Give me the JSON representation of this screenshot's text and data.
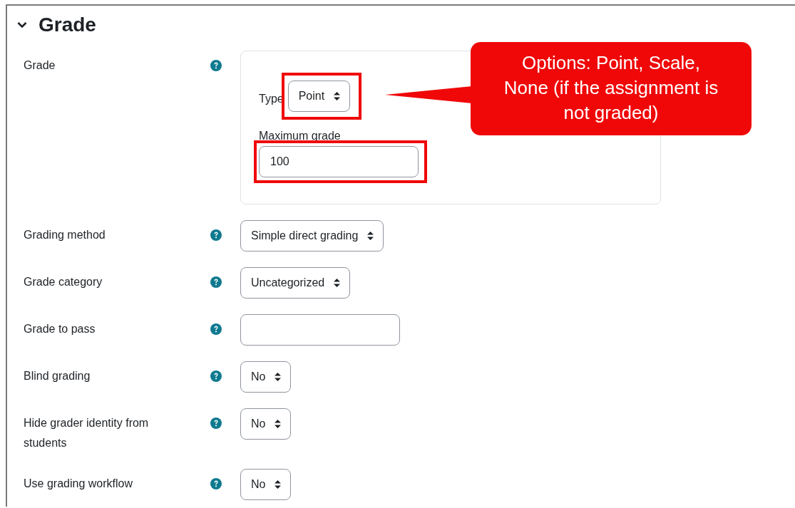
{
  "section": {
    "title": "Grade",
    "expanded": true
  },
  "grade_group": {
    "label": "Grade",
    "type_label": "Type",
    "type_value": "Point",
    "type_highlighted": true,
    "max_label": "Maximum grade",
    "max_value": "100",
    "max_highlighted": true
  },
  "callout": {
    "text": "Options: Point, Scale, None (if the assignment is not graded)"
  },
  "fields": [
    {
      "kind": "select",
      "label": "Grading method",
      "value": "Simple direct grading"
    },
    {
      "kind": "select",
      "label": "Grade category",
      "value": "Uncategorized"
    },
    {
      "kind": "input",
      "label": "Grade to pass"
    },
    {
      "kind": "select",
      "label": "Blind grading",
      "value": "No"
    },
    {
      "kind": "select",
      "label": "Hide grader identity from students",
      "value": "No"
    },
    {
      "kind": "select",
      "label": "Use grading workflow",
      "value": "No"
    }
  ]
}
